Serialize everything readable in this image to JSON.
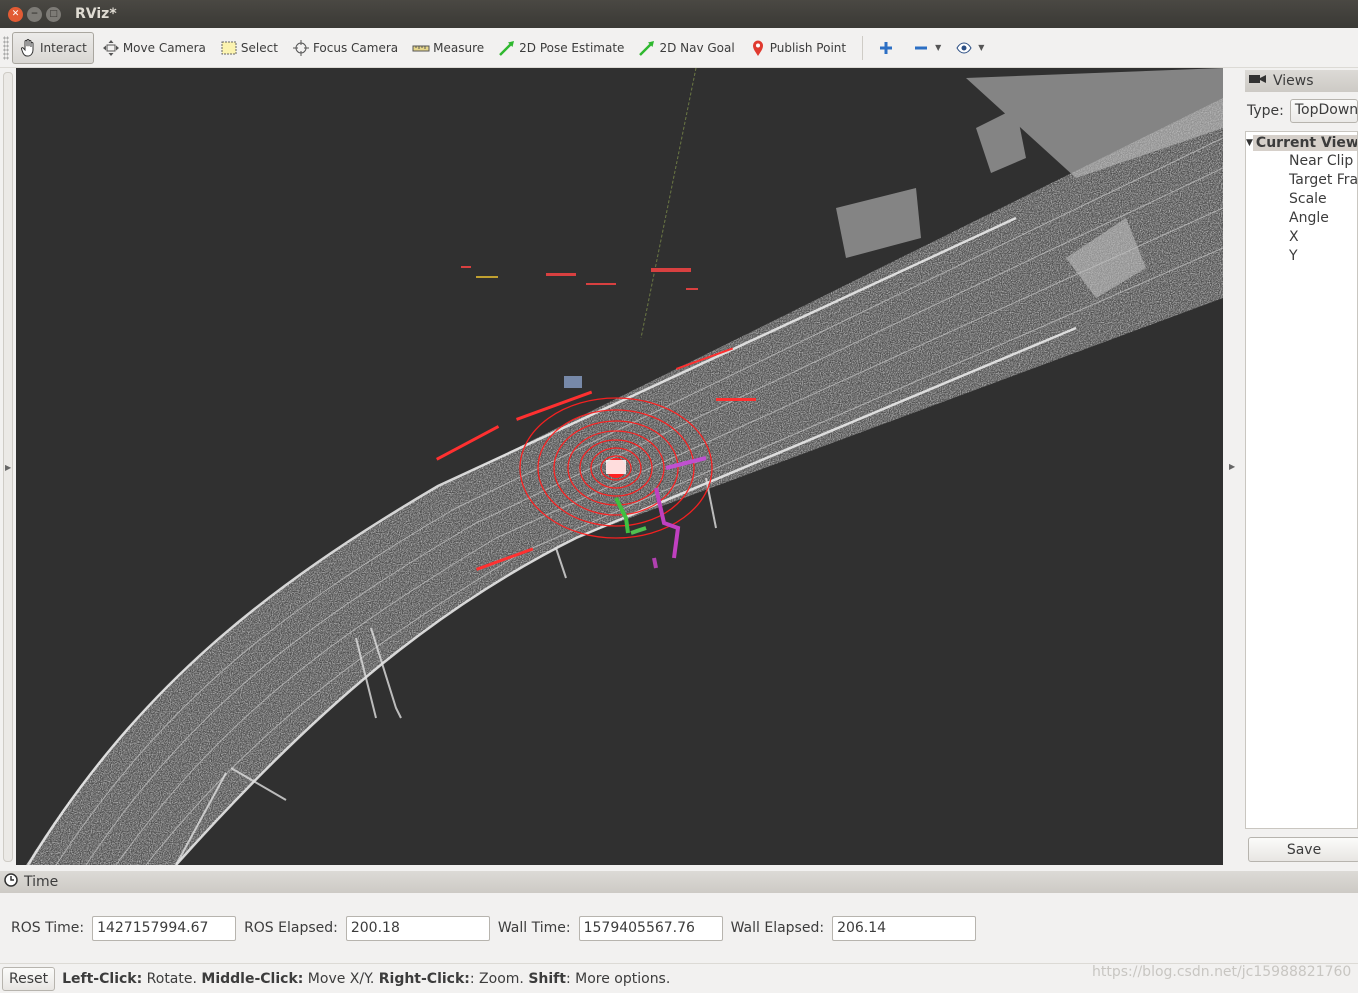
{
  "window": {
    "title": "RViz*"
  },
  "toolbar": {
    "tools": [
      {
        "label": "Interact",
        "icon": "hand-icon",
        "active": true
      },
      {
        "label": "Move Camera",
        "icon": "move-camera-icon",
        "active": false
      },
      {
        "label": "Select",
        "icon": "select-icon",
        "active": false
      },
      {
        "label": "Focus Camera",
        "icon": "focus-camera-icon",
        "active": false
      },
      {
        "label": "Measure",
        "icon": "ruler-icon",
        "active": false
      },
      {
        "label": "2D Pose Estimate",
        "icon": "green-arrow-icon",
        "active": false
      },
      {
        "label": "2D Nav Goal",
        "icon": "green-arrow-icon",
        "active": false
      },
      {
        "label": "Publish Point",
        "icon": "map-pin-icon",
        "active": false
      }
    ]
  },
  "views": {
    "title": "Views",
    "type_label": "Type:",
    "type_value": "TopDownOrtho",
    "current_view": "Current View",
    "properties": [
      "Near Clip D",
      "Target Fra",
      "Scale",
      "Angle",
      "X",
      "Y"
    ],
    "save_label": "Save"
  },
  "time": {
    "title": "Time",
    "ros_time_label": "ROS Time:",
    "ros_time": "1427157994.67",
    "ros_elapsed_label": "ROS Elapsed:",
    "ros_elapsed": "200.18",
    "wall_time_label": "Wall Time:",
    "wall_time": "1579405567.76",
    "wall_elapsed_label": "Wall Elapsed:",
    "wall_elapsed": "206.14"
  },
  "status": {
    "reset_label": "Reset",
    "hint_left_click": "Left-Click:",
    "hint_rotate": " Rotate. ",
    "hint_middle_click": "Middle-Click:",
    "hint_move": " Move X/Y. ",
    "hint_right_click": "Right-Click:",
    "hint_zoom": ": Zoom. ",
    "hint_shift": "Shift",
    "hint_more": ": More options."
  },
  "watermark": "https://blog.csdn.net/jc15988821760",
  "colors": {
    "viewport_bg": "#303030",
    "laser_red": "#ff2020",
    "point_cloud": "#d8d8d8",
    "path_magenta": "#c040c0",
    "path_green": "#40c040"
  }
}
